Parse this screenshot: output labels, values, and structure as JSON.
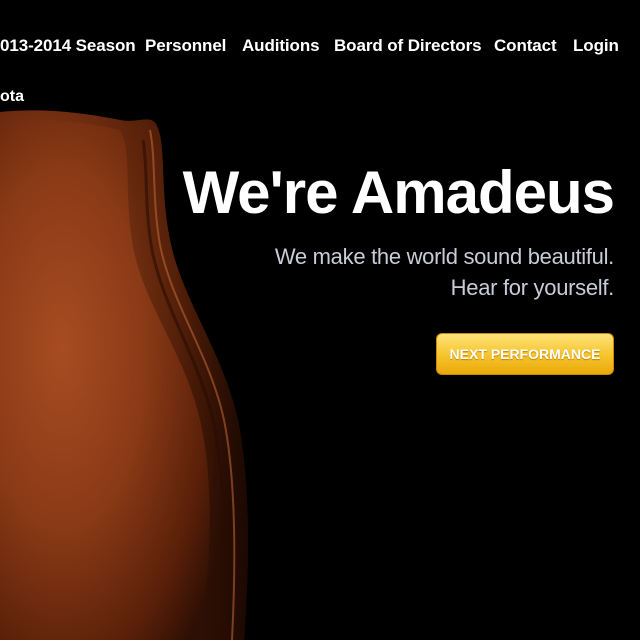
{
  "nav": {
    "items": [
      {
        "label": "013-2014 Season"
      },
      {
        "label": "Personnel"
      },
      {
        "label": "Auditions"
      },
      {
        "label": "Board of Directors"
      },
      {
        "label": "Contact"
      },
      {
        "label": "Login"
      }
    ],
    "second_row_fragment": "ota"
  },
  "hero": {
    "headline": "We're Amadeus",
    "tagline_line1": "We make the world sound beautiful.",
    "tagline_line2": "Hear for yourself.",
    "cta_label": "NEXT PERFORMANCE"
  },
  "colors": {
    "background": "#000000",
    "violin_wood": "#8a3a16",
    "cta_gold": "#f6c32a",
    "tagline": "#c8ccd8"
  }
}
